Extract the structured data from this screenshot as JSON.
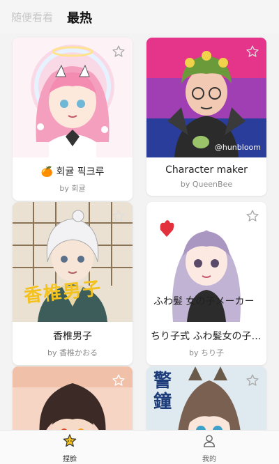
{
  "header": {
    "tabs": [
      {
        "label": "随便看看",
        "active": false
      },
      {
        "label": "最热",
        "active": true
      }
    ]
  },
  "cards": [
    {
      "title": "🍊 회귤 픽크루",
      "author": "by 회귤",
      "theme": "pink-angel",
      "favorited": false
    },
    {
      "title": "Character maker",
      "author": "by QueenBee",
      "theme": "pride-flag-char",
      "favorited": false
    },
    {
      "title": "香椎男子",
      "author": "by 香椎かおる",
      "theme": "white-hair-boy",
      "favorited": false
    },
    {
      "title": "ちり子式 ふわ髪女の子メーカー",
      "author": "by ちり子",
      "theme": "lavender-hair-girl",
      "favorited": false
    },
    {
      "title": "",
      "author": "",
      "theme": "curly-hair-boy",
      "favorited": false
    },
    {
      "title": "",
      "author": "",
      "theme": "elf-cat-girl",
      "favorited": false
    }
  ],
  "watermark_text": "@hunbloom",
  "card3_overlay_text": "香椎男子",
  "card4_overlay_text": "ふわ髪 女の子メーカー",
  "card6_overlay_text": "警 鐘",
  "bottom_nav": [
    {
      "label": "捏脸",
      "icon": "star-face-icon",
      "active": true
    },
    {
      "label": "我的",
      "icon": "user-icon",
      "active": false
    }
  ],
  "colors": {
    "background": "#f3f3f3",
    "card_bg": "#ffffff",
    "accent_yellow": "#f6c21c"
  }
}
